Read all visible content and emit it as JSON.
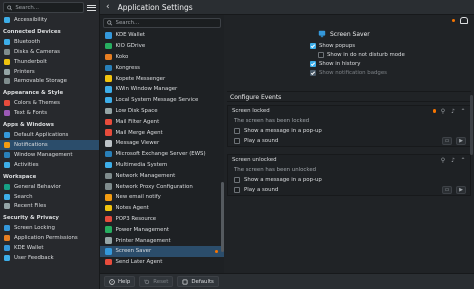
{
  "sidebar": {
    "search_placeholder": "Search...",
    "top_items": [
      {
        "label": "Accessibility",
        "icon": "accessibility-icon",
        "color": "#3daee9"
      }
    ],
    "categories": [
      {
        "title": "Connected Devices",
        "items": [
          {
            "label": "Bluetooth",
            "icon": "bluetooth-icon",
            "color": "#3daee9"
          },
          {
            "label": "Disks & Cameras",
            "icon": "disk-icon",
            "color": "#7f8c8d"
          },
          {
            "label": "Thunderbolt",
            "icon": "thunderbolt-icon",
            "color": "#f1c40f"
          },
          {
            "label": "Printers",
            "icon": "printer-icon",
            "color": "#95a5a6"
          },
          {
            "label": "Removable Storage",
            "icon": "storage-icon",
            "color": "#7f8c8d"
          }
        ]
      },
      {
        "title": "Appearance & Style",
        "items": [
          {
            "label": "Colors & Themes",
            "icon": "palette-icon",
            "color": "#e74c3c"
          },
          {
            "label": "Text & Fonts",
            "icon": "font-icon",
            "color": "#9b59b6"
          }
        ]
      },
      {
        "title": "Apps & Windows",
        "items": [
          {
            "label": "Default Applications",
            "icon": "default-apps-icon",
            "color": "#3498db"
          },
          {
            "label": "Notifications",
            "icon": "bell-icon",
            "color": "#f39c12",
            "selected": true
          },
          {
            "label": "Window Management",
            "icon": "window-icon",
            "color": "#2980b9"
          },
          {
            "label": "Activities",
            "icon": "activities-icon",
            "color": "#3daee9"
          }
        ]
      },
      {
        "title": "Workspace",
        "items": [
          {
            "label": "General Behavior",
            "icon": "behavior-icon",
            "color": "#16a085"
          },
          {
            "label": "Search",
            "icon": "search-icon",
            "color": "#3daee9"
          },
          {
            "label": "Recent Files",
            "icon": "recent-files-icon",
            "color": "#95a5a6"
          }
        ]
      },
      {
        "title": "Security & Privacy",
        "items": [
          {
            "label": "Screen Locking",
            "icon": "lock-icon",
            "color": "#3498db"
          },
          {
            "label": "Application Permissions",
            "icon": "permissions-icon",
            "color": "#e67e22"
          },
          {
            "label": "KDE Wallet",
            "icon": "wallet-icon",
            "color": "#3498db"
          },
          {
            "label": "User Feedback",
            "icon": "feedback-icon",
            "color": "#3daee9"
          }
        ]
      }
    ]
  },
  "header": {
    "title": "Application Settings",
    "back_icon": "back-arrow-icon"
  },
  "app_list": {
    "search_placeholder": "Search...",
    "items": [
      {
        "label": "KDE Wallet",
        "color": "#3498db"
      },
      {
        "label": "KIO GDrive",
        "color": "#27ae60"
      },
      {
        "label": "Koko",
        "color": "#e67e22"
      },
      {
        "label": "Kongress",
        "color": "#2980b9"
      },
      {
        "label": "Kopete Messenger",
        "color": "#f1c40f"
      },
      {
        "label": "KWin Window Manager",
        "color": "#3daee9"
      },
      {
        "label": "Local System Message Service",
        "color": "#3daee9"
      },
      {
        "label": "Low Disk Space",
        "color": "#95a5a6"
      },
      {
        "label": "Mail Filter Agent",
        "color": "#e74c3c"
      },
      {
        "label": "Mail Merge Agent",
        "color": "#e74c3c"
      },
      {
        "label": "Message Viewer",
        "color": "#bdc3c7"
      },
      {
        "label": "Microsoft Exchange Server (EWS)",
        "color": "#2980b9"
      },
      {
        "label": "Multimedia System",
        "color": "#3daee9"
      },
      {
        "label": "Network Management",
        "color": "#7f8c8d"
      },
      {
        "label": "Network Proxy Configuration",
        "color": "#7f8c8d"
      },
      {
        "label": "New email notify",
        "color": "#f39c12"
      },
      {
        "label": "Notes Agent",
        "color": "#f1c40f"
      },
      {
        "label": "POP3 Resource",
        "color": "#e74c3c"
      },
      {
        "label": "Power Management",
        "color": "#27ae60"
      },
      {
        "label": "Printer Management",
        "color": "#95a5a6"
      },
      {
        "label": "Screen Saver",
        "color": "#3498db",
        "selected": true,
        "modified": true
      },
      {
        "label": "Send Later Agent",
        "color": "#e74c3c"
      }
    ]
  },
  "settings": {
    "app_name": "Screen Saver",
    "popup_options": [
      {
        "label": "Show popups",
        "checked": true,
        "disabled": false,
        "indent": false
      },
      {
        "label": "Show in do not disturb mode",
        "checked": false,
        "disabled": false,
        "indent": true
      },
      {
        "label": "Show in history",
        "checked": true,
        "disabled": false,
        "indent": false
      },
      {
        "label": "Show notification badges",
        "checked": true,
        "disabled": true,
        "indent": false
      }
    ],
    "configure_events_title": "Configure Events",
    "events": [
      {
        "title": "Screen locked",
        "subtitle": "The screen has been locked",
        "popup_label": "Show a message in a pop-up",
        "sound_label": "Play a sound"
      },
      {
        "title": "Screen unlocked",
        "subtitle": "The screen has been unlocked",
        "popup_label": "Show a message in a pop-up",
        "sound_label": "Play a sound"
      }
    ]
  },
  "footer": {
    "help_label": "Help",
    "reset_label": "Reset",
    "defaults_label": "Defaults"
  }
}
